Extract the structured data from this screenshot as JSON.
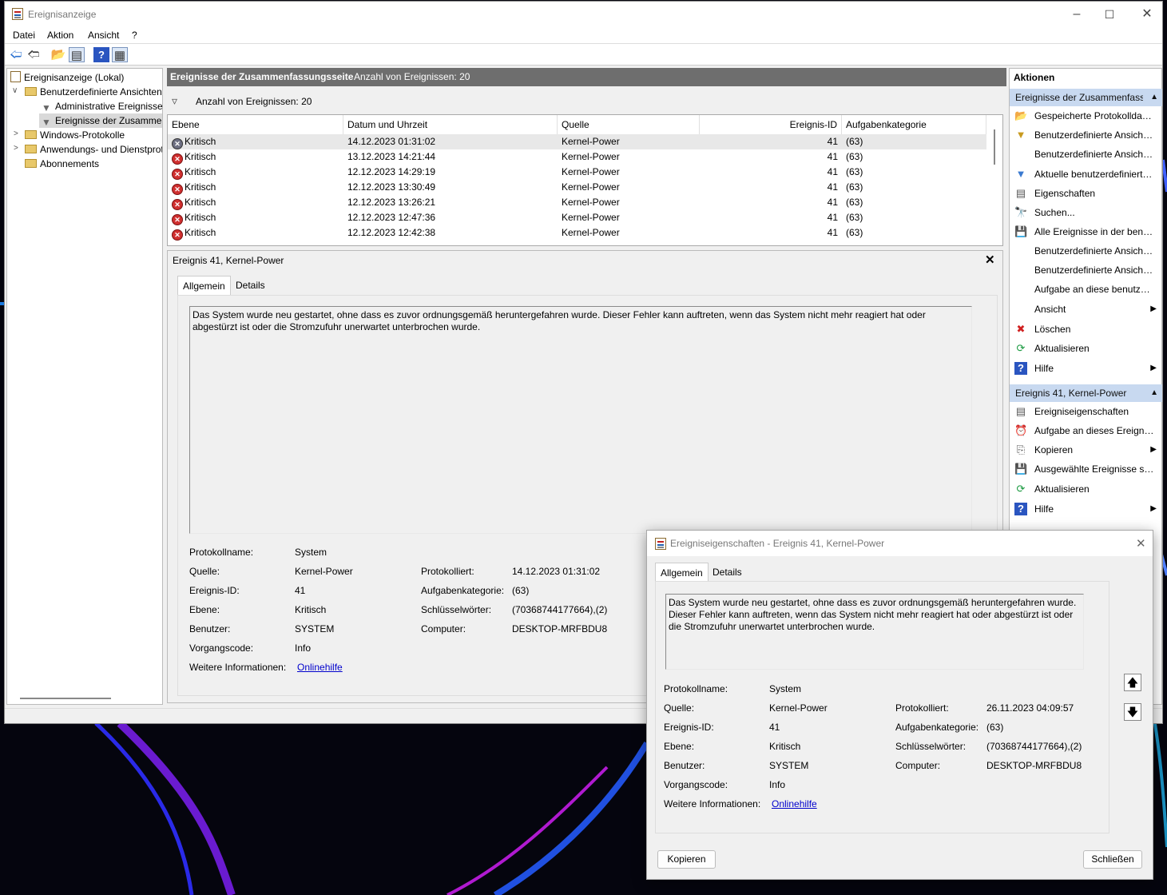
{
  "window": {
    "title": "Ereignisanzeige"
  },
  "menu": [
    "Datei",
    "Aktion",
    "Ansicht",
    "?"
  ],
  "tree": {
    "root": "Ereignisanzeige (Lokal)",
    "custom_views": "Benutzerdefinierte Ansichten",
    "admin_events": "Administrative Ereignisse",
    "summary_events": "Ereignisse der Zusammenfassungsseite",
    "windows_logs": "Windows-Protokolle",
    "app_logs": "Anwendungs- und Dienstprotokolle",
    "subscriptions": "Abonnements"
  },
  "header": {
    "title": "Ereignisse der Zusammenfassungsseite",
    "count": "Anzahl von Ereignissen: 20"
  },
  "filter": {
    "count": "Anzahl von Ereignissen: 20"
  },
  "columns": [
    "Ebene",
    "Datum und Uhrzeit",
    "Quelle",
    "Ereignis-ID",
    "Aufgabenkategorie"
  ],
  "events": [
    {
      "level": "Kritisch",
      "datetime": "14.12.2023 01:31:02",
      "source": "Kernel-Power",
      "id": "41",
      "category": "(63)"
    },
    {
      "level": "Kritisch",
      "datetime": "13.12.2023 14:21:44",
      "source": "Kernel-Power",
      "id": "41",
      "category": "(63)"
    },
    {
      "level": "Kritisch",
      "datetime": "12.12.2023 14:29:19",
      "source": "Kernel-Power",
      "id": "41",
      "category": "(63)"
    },
    {
      "level": "Kritisch",
      "datetime": "12.12.2023 13:30:49",
      "source": "Kernel-Power",
      "id": "41",
      "category": "(63)"
    },
    {
      "level": "Kritisch",
      "datetime": "12.12.2023 13:26:21",
      "source": "Kernel-Power",
      "id": "41",
      "category": "(63)"
    },
    {
      "level": "Kritisch",
      "datetime": "12.12.2023 12:47:36",
      "source": "Kernel-Power",
      "id": "41",
      "category": "(63)"
    },
    {
      "level": "Kritisch",
      "datetime": "12.12.2023 12:42:38",
      "source": "Kernel-Power",
      "id": "41",
      "category": "(63)"
    }
  ],
  "detail": {
    "title": "Ereignis 41, Kernel-Power",
    "tab_general": "Allgemein",
    "tab_details": "Details",
    "message": "Das System wurde neu gestartet, ohne dass es zuvor ordnungsgemäß heruntergefahren wurde. Dieser Fehler kann auftreten, wenn das System nicht mehr reagiert hat oder abgestürzt ist oder die Stromzufuhr unerwartet unterbrochen wurde.",
    "labels": {
      "log": "Protokollname:",
      "source": "Quelle:",
      "event_id": "Ereignis-ID:",
      "level": "Ebene:",
      "user": "Benutzer:",
      "opcode": "Vorgangscode:",
      "more_info": "Weitere Informationen:",
      "logged": "Protokolliert:",
      "category": "Aufgabenkategorie:",
      "keywords": "Schlüsselwörter:",
      "computer": "Computer:"
    },
    "values": {
      "log": "System",
      "source": "Kernel-Power",
      "event_id": "41",
      "level": "Kritisch",
      "user": "SYSTEM",
      "opcode": "Info",
      "more_info": "Onlinehilfe",
      "logged": "14.12.2023 01:31:02",
      "category": "(63)",
      "keywords": "(70368744177664),(2)",
      "computer": "DESKTOP-MRFBDU8"
    }
  },
  "actions": {
    "header": "Aktionen",
    "section1": "Ereignisse der Zusammenfassungsseite",
    "items1": [
      "Gespeicherte Protokolldatei öffnen...",
      "Benutzerdefinierte Ansicht erstellen...",
      "Benutzerdefinierte Ansicht importieren...",
      "Aktuelle benutzerdefinierte Ansicht filtern...",
      "Eigenschaften",
      "Suchen...",
      "Alle Ereignisse in der benutzerdefinierten Ansicht speichern unter...",
      "Benutzerdefinierte Ansicht exportieren...",
      "Benutzerdefinierte Ansicht kopieren...",
      "Aufgabe an diese benutzerdefinierte Ansicht anfügen...",
      "Ansicht",
      "Löschen",
      "Aktualisieren",
      "Hilfe"
    ],
    "section2": "Ereignis 41, Kernel-Power",
    "items2": [
      "Ereigniseigenschaften",
      "Aufgabe an dieses Ereignis anfügen...",
      "Kopieren",
      "Ausgewählte Ereignisse speichern...",
      "Aktualisieren",
      "Hilfe"
    ]
  },
  "dialog": {
    "title": "Ereigniseigenschaften - Ereignis 41, Kernel-Power",
    "tab_general": "Allgemein",
    "tab_details": "Details",
    "message": "Das System wurde neu gestartet, ohne dass es zuvor ordnungsgemäß heruntergefahren wurde. Dieser Fehler kann auftreten, wenn das System nicht mehr reagiert hat oder abgestürzt ist oder die Stromzufuhr unerwartet unterbrochen wurde.",
    "values": {
      "log": "System",
      "source": "Kernel-Power",
      "event_id": "41",
      "level": "Kritisch",
      "user": "SYSTEM",
      "opcode": "Info",
      "more_info": "Onlinehilfe",
      "logged": "26.11.2023 04:09:57",
      "category": "(63)",
      "keywords": "(70368744177664),(2)",
      "computer": "DESKTOP-MRFBDU8"
    },
    "copy_button": "Kopieren",
    "close_button": "Schließen"
  },
  "colors": {
    "header_bar": "#6e6e6e",
    "action_section": "#c8d9f0",
    "critical": "#d03030",
    "link": "#0000cc"
  }
}
